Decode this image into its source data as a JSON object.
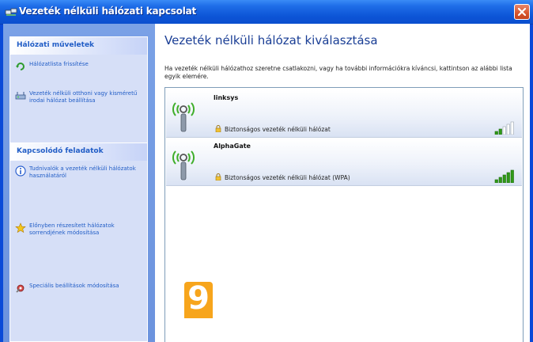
{
  "window": {
    "title": "Vezeték nélküli hálózati kapcsolat"
  },
  "left_panel": {
    "network_tasks": {
      "title": "Hálózati műveletek",
      "items": [
        {
          "icon": "refresh-icon",
          "label": "Hálózatlista frissítése"
        },
        {
          "icon": "wireless-setup-icon",
          "label": "Vezeték nélküli otthoni vagy kisméretű irodai hálózat beállítása"
        }
      ]
    },
    "related_tasks": {
      "title": "Kapcsolódó feladatok",
      "items": [
        {
          "icon": "info-icon",
          "label": "Tudnivalók a vezeték nélküli hálózatok használatáról"
        },
        {
          "icon": "star-icon",
          "label": "Előnyben részesített hálózatok sorrendjének módosítása"
        },
        {
          "icon": "settings-icon",
          "label": "Speciális beállítások módosítása"
        }
      ]
    }
  },
  "main": {
    "heading": "Vezeték nélküli hálózat kiválasztása",
    "description": "Ha vezeték nélküli hálózathoz szeretne csatlakozni, vagy ha további információkra kíváncsi, kattintson az alábbi lista egyik elemére.",
    "networks": [
      {
        "name": "linksys",
        "security": "Biztonságos vezeték nélküli hálózat",
        "signal_bars": 2,
        "signal_max": 5
      },
      {
        "name": "AlphaGate",
        "security": "Biztonságos vezeték nélküli hálózat (WPA)",
        "signal_bars": 5,
        "signal_max": 5
      }
    ]
  },
  "overlay": {
    "step_number": "9",
    "color": "#f7a51c"
  },
  "colors": {
    "titlebar": "#0c54d6",
    "task_text": "#215dc6",
    "heading": "#1a3e95",
    "signal_on": "#2f9a17"
  }
}
